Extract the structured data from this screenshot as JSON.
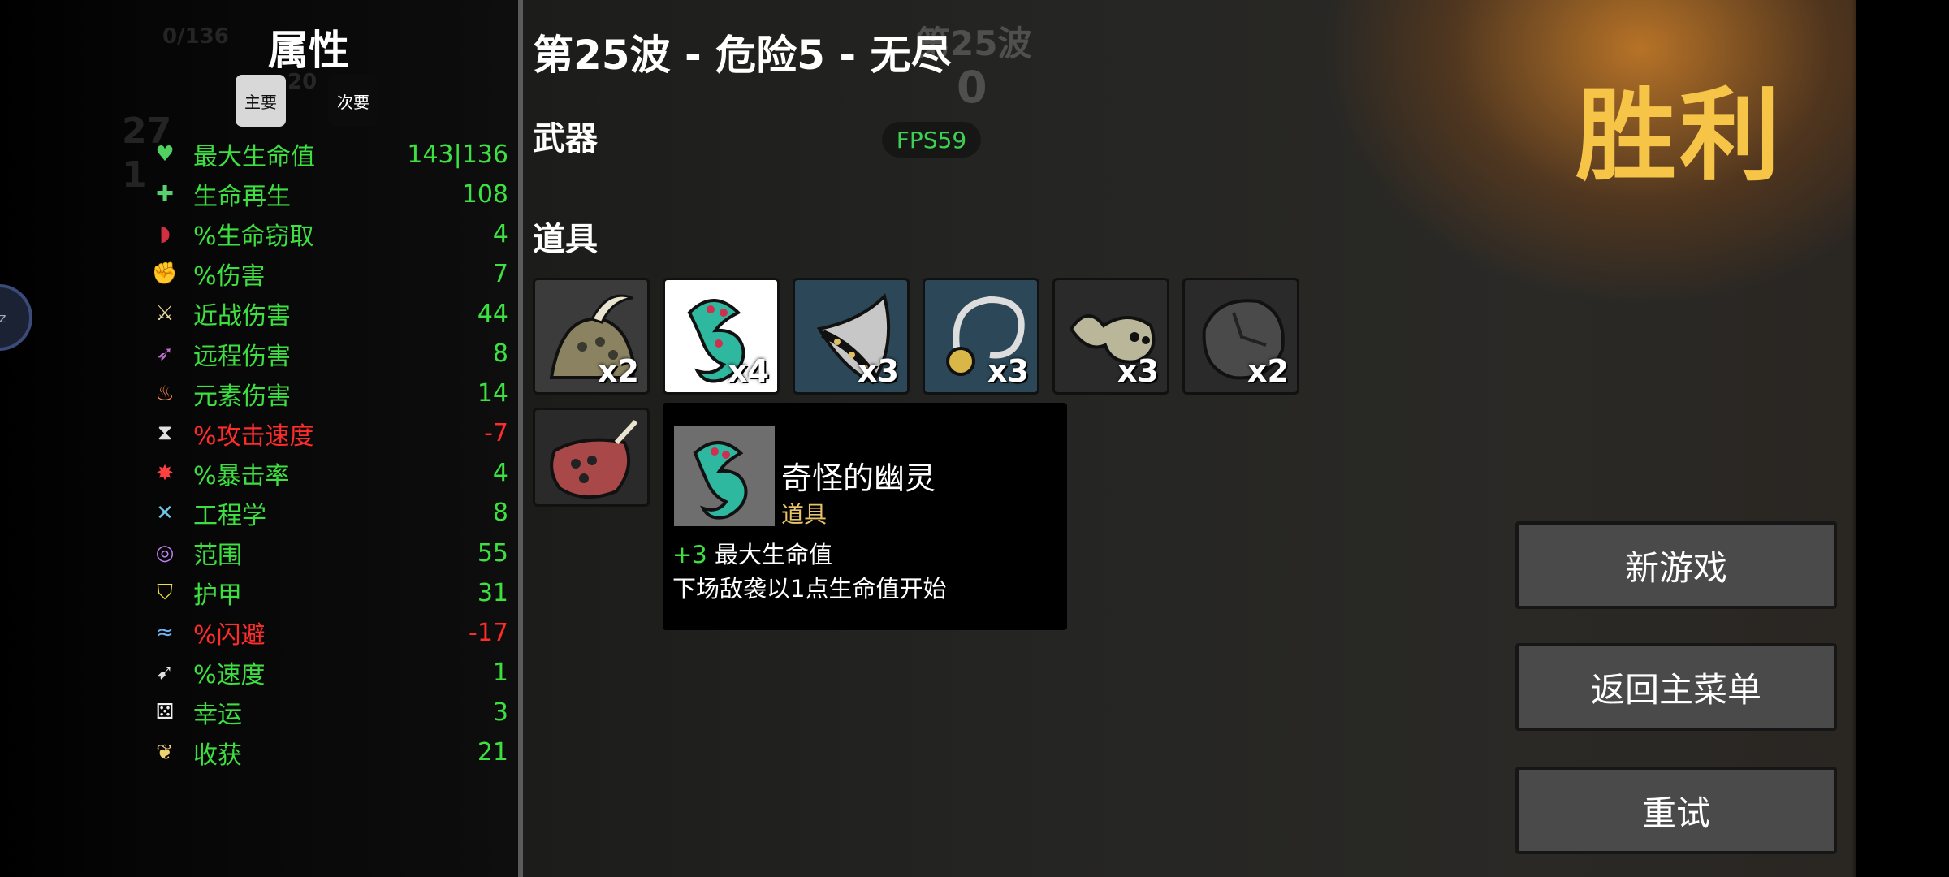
{
  "ghost_hud": {
    "xp": "0/136",
    "level_bar": "20",
    "materials": "27",
    "bag": "1"
  },
  "stats": {
    "title": "属性",
    "tabs": {
      "primary": "主要",
      "secondary": "次要"
    },
    "rows": [
      {
        "icon": "heart-icon",
        "name": "最大生命值",
        "value": "143|136",
        "color": "green"
      },
      {
        "icon": "regen-icon",
        "name": "生命再生",
        "value": "108",
        "color": "green"
      },
      {
        "icon": "lifesteal-icon",
        "name": "%生命窃取",
        "value": "4",
        "color": "green"
      },
      {
        "icon": "damage-icon",
        "name": "%伤害",
        "value": "7",
        "color": "green"
      },
      {
        "icon": "melee-icon",
        "name": "近战伤害",
        "value": "44",
        "color": "green"
      },
      {
        "icon": "ranged-icon",
        "name": "远程伤害",
        "value": "8",
        "color": "green"
      },
      {
        "icon": "elemental-icon",
        "name": "元素伤害",
        "value": "14",
        "color": "green"
      },
      {
        "icon": "hourglass-icon",
        "name": "%攻击速度",
        "value": "-7",
        "color": "red"
      },
      {
        "icon": "crit-icon",
        "name": "%暴击率",
        "value": "4",
        "color": "green"
      },
      {
        "icon": "engineering-icon",
        "name": "工程学",
        "value": "8",
        "color": "green"
      },
      {
        "icon": "range-icon",
        "name": "范围",
        "value": "55",
        "color": "green"
      },
      {
        "icon": "armor-icon",
        "name": "护甲",
        "value": "31",
        "color": "green"
      },
      {
        "icon": "dodge-icon",
        "name": "%闪避",
        "value": "-17",
        "color": "red"
      },
      {
        "icon": "speed-icon",
        "name": "%速度",
        "value": "1",
        "color": "green"
      },
      {
        "icon": "luck-icon",
        "name": "幸运",
        "value": "3",
        "color": "green"
      },
      {
        "icon": "harvest-icon",
        "name": "收获",
        "value": "21",
        "color": "green"
      }
    ]
  },
  "header": {
    "wave_title": "第25波 - 危险5 - 无尽",
    "wave_ghost": "第25波",
    "count_ghost": "0",
    "fps": "FPS59"
  },
  "sections": {
    "weapons": "武器",
    "items": "道具"
  },
  "victory": "胜利",
  "items": [
    {
      "icon": "horned-helmet-icon",
      "count": "x2",
      "bg": "#3b3b3b"
    },
    {
      "icon": "strange-ghost-icon",
      "count": "x4",
      "bg": "#ffffff"
    },
    {
      "icon": "blade-armor-icon",
      "count": "x3",
      "bg": "#2c4858"
    },
    {
      "icon": "hook-amulet-icon",
      "count": "x3",
      "bg": "#2c4858"
    },
    {
      "icon": "tadpole-icon",
      "count": "x3",
      "bg": "#2a2a2a"
    },
    {
      "icon": "rock-icon",
      "count": "x2",
      "bg": "#2a2a2a"
    },
    {
      "icon": "demon-mask-icon",
      "count": "",
      "bg": "#2a2a2a"
    }
  ],
  "tooltip": {
    "name": "奇怪的幽灵",
    "type": "道具",
    "bonus_value": "+3",
    "bonus_text": "最大生命值",
    "effect": "下场敌袭以1点生命值开始"
  },
  "buttons": {
    "new_game": "新游戏",
    "main_menu": "返回主菜单",
    "retry": "重试"
  },
  "colors": {
    "stat_green": "#3de040",
    "stat_red": "#ff2c2c",
    "victory_gold": "#f6c447",
    "tooltip_type": "#e7c36a"
  }
}
